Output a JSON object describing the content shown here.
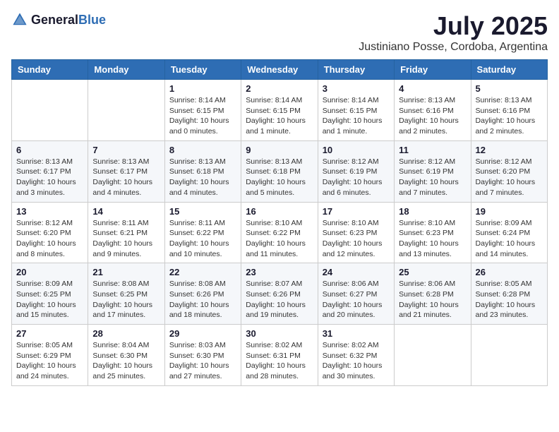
{
  "header": {
    "logo_general": "General",
    "logo_blue": "Blue",
    "month_title": "July 2025",
    "location": "Justiniano Posse, Cordoba, Argentina"
  },
  "calendar": {
    "days_of_week": [
      "Sunday",
      "Monday",
      "Tuesday",
      "Wednesday",
      "Thursday",
      "Friday",
      "Saturday"
    ],
    "weeks": [
      [
        {
          "day": "",
          "detail": ""
        },
        {
          "day": "",
          "detail": ""
        },
        {
          "day": "1",
          "detail": "Sunrise: 8:14 AM\nSunset: 6:15 PM\nDaylight: 10 hours and 0 minutes."
        },
        {
          "day": "2",
          "detail": "Sunrise: 8:14 AM\nSunset: 6:15 PM\nDaylight: 10 hours and 1 minute."
        },
        {
          "day": "3",
          "detail": "Sunrise: 8:14 AM\nSunset: 6:15 PM\nDaylight: 10 hours and 1 minute."
        },
        {
          "day": "4",
          "detail": "Sunrise: 8:13 AM\nSunset: 6:16 PM\nDaylight: 10 hours and 2 minutes."
        },
        {
          "day": "5",
          "detail": "Sunrise: 8:13 AM\nSunset: 6:16 PM\nDaylight: 10 hours and 2 minutes."
        }
      ],
      [
        {
          "day": "6",
          "detail": "Sunrise: 8:13 AM\nSunset: 6:17 PM\nDaylight: 10 hours and 3 minutes."
        },
        {
          "day": "7",
          "detail": "Sunrise: 8:13 AM\nSunset: 6:17 PM\nDaylight: 10 hours and 4 minutes."
        },
        {
          "day": "8",
          "detail": "Sunrise: 8:13 AM\nSunset: 6:18 PM\nDaylight: 10 hours and 4 minutes."
        },
        {
          "day": "9",
          "detail": "Sunrise: 8:13 AM\nSunset: 6:18 PM\nDaylight: 10 hours and 5 minutes."
        },
        {
          "day": "10",
          "detail": "Sunrise: 8:12 AM\nSunset: 6:19 PM\nDaylight: 10 hours and 6 minutes."
        },
        {
          "day": "11",
          "detail": "Sunrise: 8:12 AM\nSunset: 6:19 PM\nDaylight: 10 hours and 7 minutes."
        },
        {
          "day": "12",
          "detail": "Sunrise: 8:12 AM\nSunset: 6:20 PM\nDaylight: 10 hours and 7 minutes."
        }
      ],
      [
        {
          "day": "13",
          "detail": "Sunrise: 8:12 AM\nSunset: 6:20 PM\nDaylight: 10 hours and 8 minutes."
        },
        {
          "day": "14",
          "detail": "Sunrise: 8:11 AM\nSunset: 6:21 PM\nDaylight: 10 hours and 9 minutes."
        },
        {
          "day": "15",
          "detail": "Sunrise: 8:11 AM\nSunset: 6:22 PM\nDaylight: 10 hours and 10 minutes."
        },
        {
          "day": "16",
          "detail": "Sunrise: 8:10 AM\nSunset: 6:22 PM\nDaylight: 10 hours and 11 minutes."
        },
        {
          "day": "17",
          "detail": "Sunrise: 8:10 AM\nSunset: 6:23 PM\nDaylight: 10 hours and 12 minutes."
        },
        {
          "day": "18",
          "detail": "Sunrise: 8:10 AM\nSunset: 6:23 PM\nDaylight: 10 hours and 13 minutes."
        },
        {
          "day": "19",
          "detail": "Sunrise: 8:09 AM\nSunset: 6:24 PM\nDaylight: 10 hours and 14 minutes."
        }
      ],
      [
        {
          "day": "20",
          "detail": "Sunrise: 8:09 AM\nSunset: 6:25 PM\nDaylight: 10 hours and 15 minutes."
        },
        {
          "day": "21",
          "detail": "Sunrise: 8:08 AM\nSunset: 6:25 PM\nDaylight: 10 hours and 17 minutes."
        },
        {
          "day": "22",
          "detail": "Sunrise: 8:08 AM\nSunset: 6:26 PM\nDaylight: 10 hours and 18 minutes."
        },
        {
          "day": "23",
          "detail": "Sunrise: 8:07 AM\nSunset: 6:26 PM\nDaylight: 10 hours and 19 minutes."
        },
        {
          "day": "24",
          "detail": "Sunrise: 8:06 AM\nSunset: 6:27 PM\nDaylight: 10 hours and 20 minutes."
        },
        {
          "day": "25",
          "detail": "Sunrise: 8:06 AM\nSunset: 6:28 PM\nDaylight: 10 hours and 21 minutes."
        },
        {
          "day": "26",
          "detail": "Sunrise: 8:05 AM\nSunset: 6:28 PM\nDaylight: 10 hours and 23 minutes."
        }
      ],
      [
        {
          "day": "27",
          "detail": "Sunrise: 8:05 AM\nSunset: 6:29 PM\nDaylight: 10 hours and 24 minutes."
        },
        {
          "day": "28",
          "detail": "Sunrise: 8:04 AM\nSunset: 6:30 PM\nDaylight: 10 hours and 25 minutes."
        },
        {
          "day": "29",
          "detail": "Sunrise: 8:03 AM\nSunset: 6:30 PM\nDaylight: 10 hours and 27 minutes."
        },
        {
          "day": "30",
          "detail": "Sunrise: 8:02 AM\nSunset: 6:31 PM\nDaylight: 10 hours and 28 minutes."
        },
        {
          "day": "31",
          "detail": "Sunrise: 8:02 AM\nSunset: 6:32 PM\nDaylight: 10 hours and 30 minutes."
        },
        {
          "day": "",
          "detail": ""
        },
        {
          "day": "",
          "detail": ""
        }
      ]
    ]
  }
}
